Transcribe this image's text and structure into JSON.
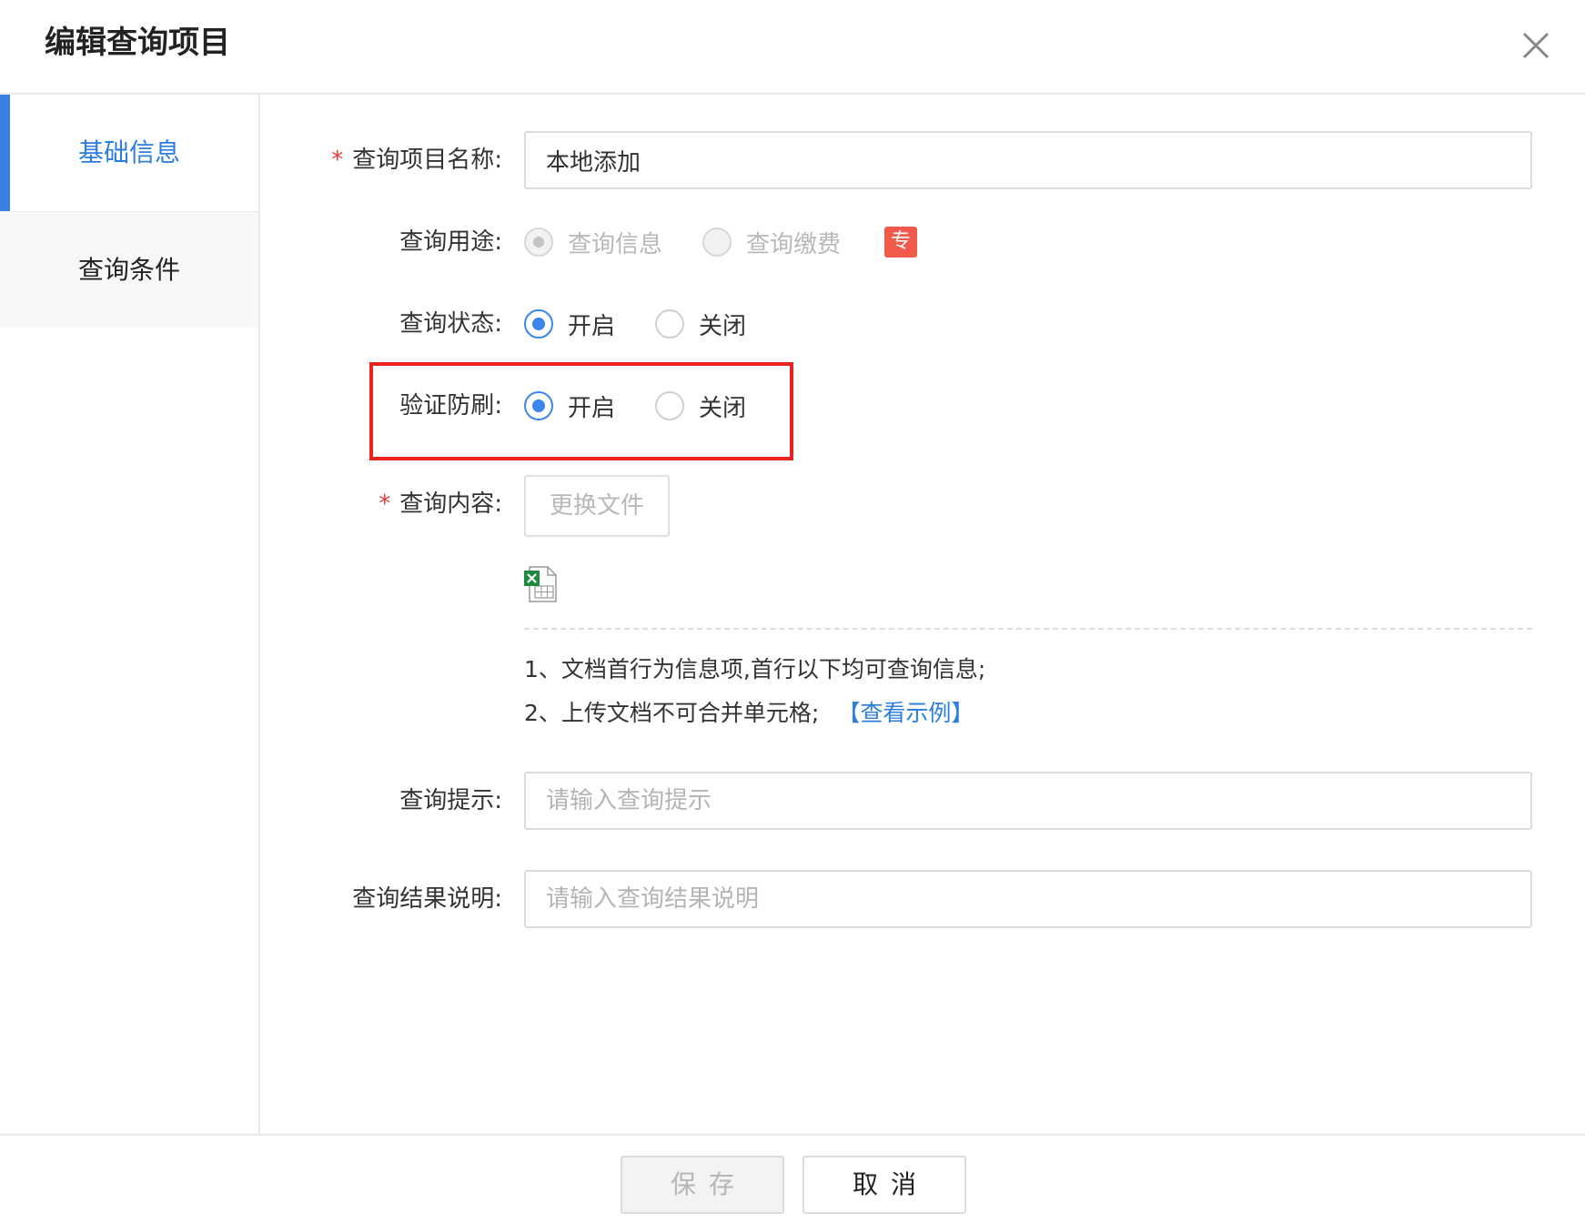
{
  "dialog": {
    "title": "编辑查询项目"
  },
  "sidebar": {
    "items": [
      {
        "label": "基础信息",
        "active": true
      },
      {
        "label": "查询条件",
        "active": false
      }
    ]
  },
  "form": {
    "name": {
      "label": "查询项目名称:",
      "required": true,
      "value": "本地添加"
    },
    "purpose": {
      "label": "查询用途:",
      "options": [
        "查询信息",
        "查询缴费"
      ],
      "selected": "查询信息",
      "disabled": true,
      "badge": "专"
    },
    "status": {
      "label": "查询状态:",
      "options": [
        "开启",
        "关闭"
      ],
      "selected": "开启"
    },
    "anti_brush": {
      "label": "验证防刷:",
      "options": [
        "开启",
        "关闭"
      ],
      "selected": "开启"
    },
    "content": {
      "label": "查询内容:",
      "required": true,
      "upload_button": "更换文件",
      "file_icon": "excel-file-icon",
      "notes": [
        "1、文档首行为信息项,首行以下均可查询信息;",
        "2、上传文档不可合并单元格;"
      ],
      "example_link": "【查看示例】"
    },
    "hint": {
      "label": "查询提示:",
      "placeholder": "请输入查询提示",
      "value": ""
    },
    "result_desc": {
      "label": "查询结果说明:",
      "placeholder": "请输入查询结果说明",
      "value": ""
    }
  },
  "footer": {
    "save_label": "保存",
    "cancel_label": "取消"
  },
  "colors": {
    "accent": "#3a86ee",
    "link": "#2b7de0",
    "required": "#e63a3a",
    "highlight": "#e8241f",
    "badge": "#f15a4a"
  }
}
